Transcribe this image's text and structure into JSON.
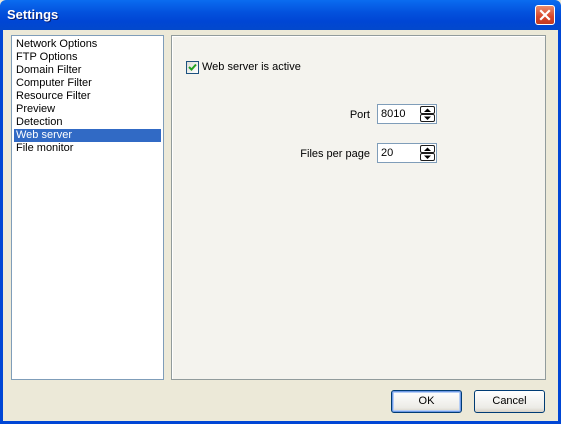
{
  "window": {
    "title": "Settings"
  },
  "sidebar": {
    "items": [
      {
        "label": "Network Options",
        "selected": false
      },
      {
        "label": "FTP Options",
        "selected": false
      },
      {
        "label": "Domain Filter",
        "selected": false
      },
      {
        "label": "Computer Filter",
        "selected": false
      },
      {
        "label": "Resource Filter",
        "selected": false
      },
      {
        "label": "Preview",
        "selected": false
      },
      {
        "label": "Detection",
        "selected": false
      },
      {
        "label": "Web server",
        "selected": true
      },
      {
        "label": "File monitor",
        "selected": false
      }
    ]
  },
  "web_server": {
    "active_label": "Web server is active",
    "active_checked": true,
    "port_label": "Port",
    "port_value": "8010",
    "files_per_page_label": "Files per page",
    "files_per_page_value": "20"
  },
  "buttons": {
    "ok": "OK",
    "cancel": "Cancel"
  },
  "icons": {
    "close": "close-icon",
    "check": "checkmark-icon",
    "spin_up": "arrow-up-icon",
    "spin_down": "arrow-down-icon"
  },
  "colors": {
    "title_bar": "#0352de",
    "selection": "#316ac5",
    "close_button": "#d8452a",
    "checkbox_check": "#21a121"
  }
}
